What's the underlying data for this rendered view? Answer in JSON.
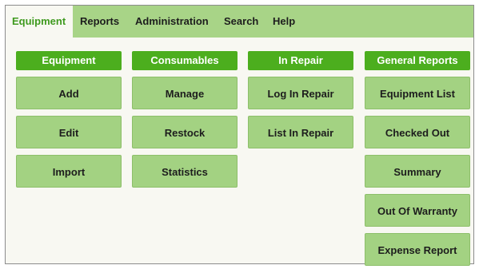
{
  "menu": {
    "items": [
      {
        "label": "Equipment",
        "active": true
      },
      {
        "label": "Reports"
      },
      {
        "label": "Administration"
      },
      {
        "label": "Search"
      },
      {
        "label": "Help"
      }
    ]
  },
  "columns": [
    {
      "header": "Equipment",
      "buttons": [
        "Add",
        "Edit",
        "Import"
      ]
    },
    {
      "header": "Consumables",
      "buttons": [
        "Manage",
        "Restock",
        "Statistics"
      ]
    },
    {
      "header": "In Repair",
      "buttons": [
        "Log In Repair",
        "List In Repair"
      ]
    },
    {
      "header": "General Reports",
      "buttons": [
        "Equipment List",
        "Checked Out",
        "Summary",
        "Out Of Warranty",
        "Expense Report"
      ]
    }
  ],
  "colors": {
    "menubar_bg": "#a8d487",
    "active_menu_text": "#3f9a1f",
    "header_bg": "#4cae1e",
    "button_bg": "#a3d282",
    "panel_bg": "#f8f8f2"
  }
}
